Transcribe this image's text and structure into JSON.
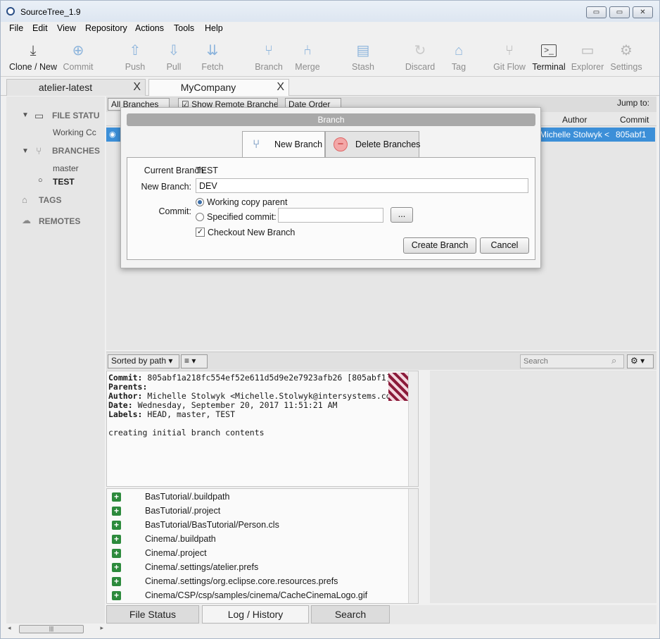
{
  "window": {
    "title": "SourceTree_1.9",
    "min_glyph": "▭",
    "max_glyph": "▭",
    "close_glyph": "✕"
  },
  "menu": [
    "File",
    "Edit",
    "View",
    "Repository",
    "Actions",
    "Tools",
    "Help"
  ],
  "toolbar": {
    "clone_new": "Clone / New",
    "commit": "Commit",
    "push": "Push",
    "pull": "Pull",
    "fetch": "Fetch",
    "branch": "Branch",
    "merge": "Merge",
    "stash": "Stash",
    "discard": "Discard",
    "tag": "Tag",
    "git_flow": "Git Flow",
    "terminal": "Terminal",
    "explorer": "Explorer",
    "settings": "Settings"
  },
  "tabs": [
    {
      "label": "atelier-latest",
      "close": "X"
    },
    {
      "label": "MyCompany",
      "close": "X"
    }
  ],
  "sidebar": {
    "file_status": "FILE STATU",
    "working_copy": "Working Cc",
    "branches": "BRANCHES",
    "master": "master",
    "test": "TEST",
    "tags": "TAGS",
    "remotes": "REMOTES"
  },
  "log": {
    "branch_filter": "All Branches",
    "show_remote": "Show Remote Branches",
    "order": "Date Order",
    "jump_to": "Jump to:",
    "col_author": "Author",
    "col_commit": "Commit",
    "row_author": "Michelle Stolwyk <",
    "row_commit": "805abf1"
  },
  "bottom": {
    "sort": "Sorted by path",
    "search_placeholder": "Search"
  },
  "details": {
    "commit_label": "Commit:",
    "commit_value": "805abf1a218fc554ef52e611d5d9e2e7923afb26 [805abf1]",
    "parents_label": "Parents:",
    "author_label": "Author:",
    "author_value": "Michelle Stolwyk <Michelle.Stolwyk@intersystems.com>",
    "date_label": "Date:",
    "date_value": "Wednesday, September 20, 2017 11:51:21 AM",
    "labels_label": "Labels:",
    "labels_value": "HEAD, master, TEST",
    "message": "creating initial branch contents"
  },
  "files": [
    "BasTutorial/.buildpath",
    "BasTutorial/.project",
    "BasTutorial/BasTutorial/Person.cls",
    "Cinema/.buildpath",
    "Cinema/.project",
    "Cinema/.settings/atelier.prefs",
    "Cinema/.settings/org.eclipse.core.resources.prefs",
    "Cinema/CSP/csp/samples/cinema/CacheCinemaLogo.gif"
  ],
  "bottom_tabs": [
    "File Status",
    "Log / History",
    "Search"
  ],
  "dialog": {
    "title": "Branch",
    "tab_new": "New Branch",
    "tab_delete": "Delete Branches",
    "current_branch_label": "Current Branch:",
    "current_branch_value": "TEST",
    "new_branch_label": "New Branch:",
    "new_branch_value": "DEV",
    "commit_label": "Commit:",
    "radio_working": "Working copy parent",
    "radio_specified": "Specified commit:",
    "browse": "...",
    "checkout": "Checkout New Branch",
    "create": "Create Branch",
    "cancel": "Cancel"
  }
}
